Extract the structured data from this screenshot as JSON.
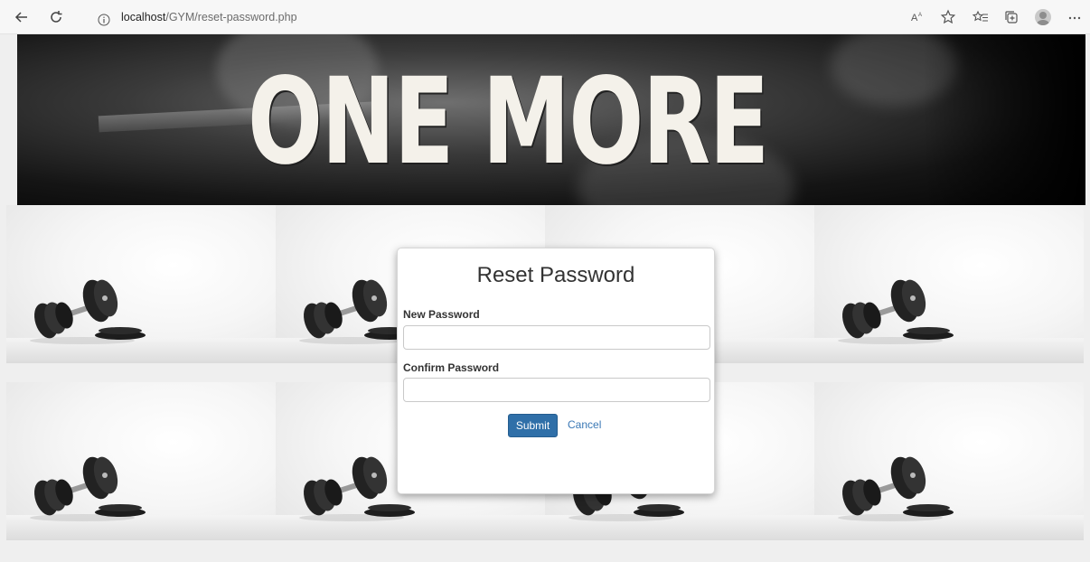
{
  "browser": {
    "url_host": "localhost",
    "url_path": "/GYM/reset-password.php"
  },
  "banner": {
    "text": "ONE MORE"
  },
  "form": {
    "title": "Reset Password",
    "new_password_label": "New Password",
    "new_password_value": "",
    "confirm_password_label": "Confirm Password",
    "confirm_password_value": "",
    "submit_label": "Submit",
    "cancel_label": "Cancel"
  },
  "colors": {
    "submit_bg": "#2f6fa8",
    "link": "#3a78b5"
  }
}
